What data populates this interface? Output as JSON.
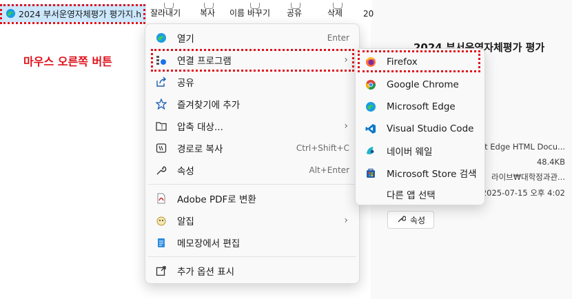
{
  "file_item": {
    "name": "2024 부서운영자체평가 평가지.h"
  },
  "toolbar": {
    "items": [
      "잘라내기",
      "복사",
      "이름 바꾸기",
      "공유",
      "삭제"
    ],
    "tab_stub": "20"
  },
  "annotation": {
    "label": "마우스 오른쪽 버튼",
    "color": "#e0101a"
  },
  "context_menu": {
    "items": [
      {
        "label": "열기",
        "shortcut": "Enter",
        "icon": "edge-icon"
      },
      {
        "label": "연결 프로그램",
        "icon": "open-with-icon",
        "has_submenu": true
      },
      {
        "label": "공유",
        "icon": "share-icon"
      },
      {
        "label": "즐겨찾기에 추가",
        "icon": "star-icon"
      },
      {
        "label": "압축 대상...",
        "icon": "zip-folder-icon",
        "has_submenu": true
      },
      {
        "label": "경로로 복사",
        "shortcut": "Ctrl+Shift+C",
        "icon": "copy-path-icon"
      },
      {
        "label": "속성",
        "shortcut": "Alt+Enter",
        "icon": "wrench-icon"
      },
      {
        "label": "Adobe PDF로 변환",
        "icon": "adobe-pdf-icon"
      },
      {
        "label": "알집",
        "icon": "alzip-icon",
        "has_submenu": true
      },
      {
        "label": "메모장에서 편집",
        "icon": "notepad-icon"
      },
      {
        "label": "추가 옵션 표시",
        "icon": "more-options-icon"
      }
    ]
  },
  "submenu": {
    "items": [
      {
        "label": "Firefox",
        "icon": "firefox-icon"
      },
      {
        "label": "Google Chrome",
        "icon": "chrome-icon"
      },
      {
        "label": "Microsoft Edge",
        "icon": "edge-icon"
      },
      {
        "label": "Visual Studio Code",
        "icon": "vscode-icon"
      },
      {
        "label": "네이버 웨일",
        "icon": "whale-icon"
      },
      {
        "label": "Microsoft Store 검색",
        "icon": "store-icon"
      },
      {
        "label": "다른 앱 선택",
        "icon": ""
      }
    ]
  },
  "details": {
    "title": "2024 부서운영자체평가 평가",
    "type": "ft Edge HTML Docu...",
    "size": "48.4KB",
    "path": "라이브₩대학정과관...",
    "date": "2025-07-15 오후 4:02",
    "properties_button": "속성"
  }
}
